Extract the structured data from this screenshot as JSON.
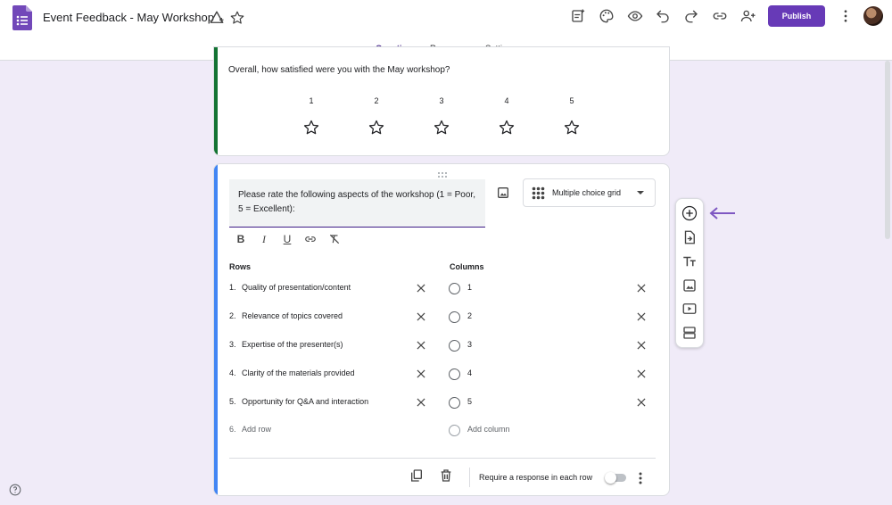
{
  "app": {
    "title": "Event Feedback - May Workshop",
    "accent_color": "#673ab7",
    "publish_label": "Publish"
  },
  "header": {
    "icons": [
      "forms-logo-icon",
      "move-to-drive-icon",
      "star-icon",
      "customize-icon",
      "palette-icon",
      "preview-eye-icon",
      "undo-icon",
      "redo-icon",
      "link-icon",
      "add-collaborator-icon",
      "more-vert-icon"
    ]
  },
  "tabs": [
    {
      "label": "Questions",
      "active": true
    },
    {
      "label": "Responses",
      "active": false
    },
    {
      "label": "Settings",
      "active": false
    }
  ],
  "rating_question": {
    "text": "Overall, how satisfied were you with the May workshop?",
    "scale": [
      "1",
      "2",
      "3",
      "4",
      "5"
    ],
    "bar_color": "#137333"
  },
  "grid_question": {
    "title": "Please rate the following aspects of the workshop (1 = Poor, 5 = Excellent):",
    "type_label": "Multiple choice grid",
    "bar_color": "#4285f4",
    "format_buttons": [
      "B",
      "I",
      "U"
    ],
    "rows_label": "Rows",
    "columns_label": "Columns",
    "rows": [
      {
        "num": "1.",
        "label": "Quality of presentation/content"
      },
      {
        "num": "2.",
        "label": "Relevance of topics covered"
      },
      {
        "num": "3.",
        "label": "Expertise of the presenter(s)"
      },
      {
        "num": "4.",
        "label": "Clarity of the materials provided"
      },
      {
        "num": "5.",
        "label": "Opportunity for Q&A and interaction"
      }
    ],
    "add_row": {
      "num": "6.",
      "label": "Add row"
    },
    "columns": [
      "1",
      "2",
      "3",
      "4",
      "5"
    ],
    "add_column": "Add column",
    "require_label": "Require a response in each row",
    "require_on": false
  },
  "side_toolbar": {
    "icons": [
      "add-question-icon",
      "import-questions-icon",
      "add-title-icon",
      "add-image-icon",
      "add-video-icon",
      "add-section-icon"
    ],
    "arrow_color": "#7e57c2"
  }
}
